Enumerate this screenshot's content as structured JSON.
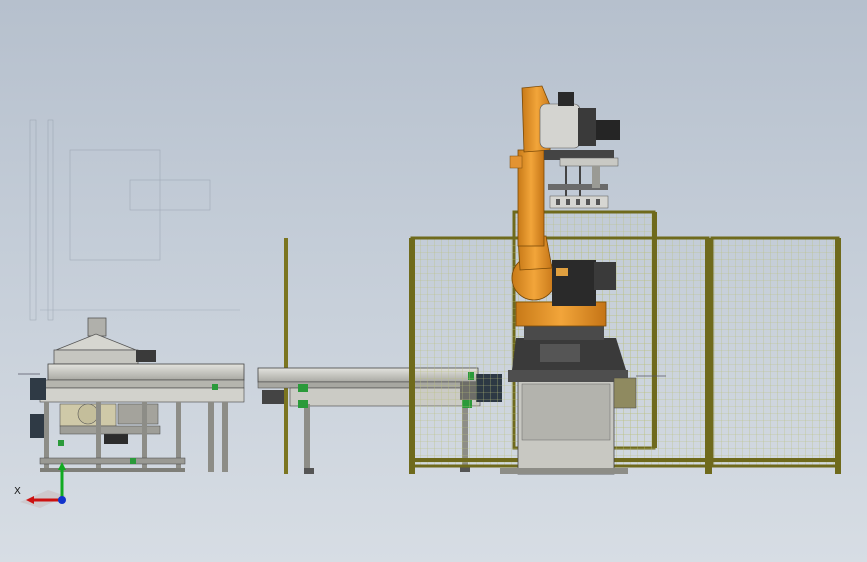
{
  "viewport": {
    "background_top": "#b6c0cd",
    "background_bottom": "#d7dde4"
  },
  "scene": {
    "robot_color": "#e9962b",
    "frame_color": "#6f6a1c",
    "mesh_color": "#b9c07a",
    "machine_color": "#c9c9c4",
    "dark_parts": "#2a2a2a"
  },
  "triad": {
    "x_label": "X",
    "x_color": "#cc1111",
    "y_color": "#11aa22",
    "z_color": "#1133cc"
  }
}
